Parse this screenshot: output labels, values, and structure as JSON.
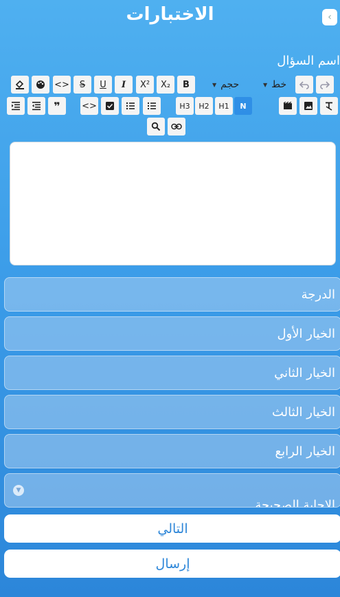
{
  "header": {
    "title": "الاختبارات",
    "back_icon": "chevron-left-icon"
  },
  "question": {
    "label": "اسم السؤال"
  },
  "toolbar": {
    "font_label": "خط",
    "size_label": "حجم",
    "normal_label": "N",
    "h1_label": "H1",
    "h2_label": "H2",
    "h3_label": "H3",
    "bold_label": "B",
    "italic_label": "I",
    "underline_label": "U",
    "strike_label": "S",
    "sub_label": "X₂",
    "sup_label": "X²",
    "code_label": "<>",
    "code2_label": "<>",
    "quote_label": "❞"
  },
  "fields": {
    "grade": "الدرجة",
    "option1": "الخيار الأول",
    "option2": "الخيار الثاني",
    "option3": "الخيار الثالث",
    "option4": "الخيار الرابع",
    "correct": "الاجابة الصحيحة"
  },
  "buttons": {
    "next": "التالي",
    "submit": "إرسال"
  },
  "colors": {
    "accent": "#2f8fe6",
    "button_text": "#2d86d8"
  }
}
